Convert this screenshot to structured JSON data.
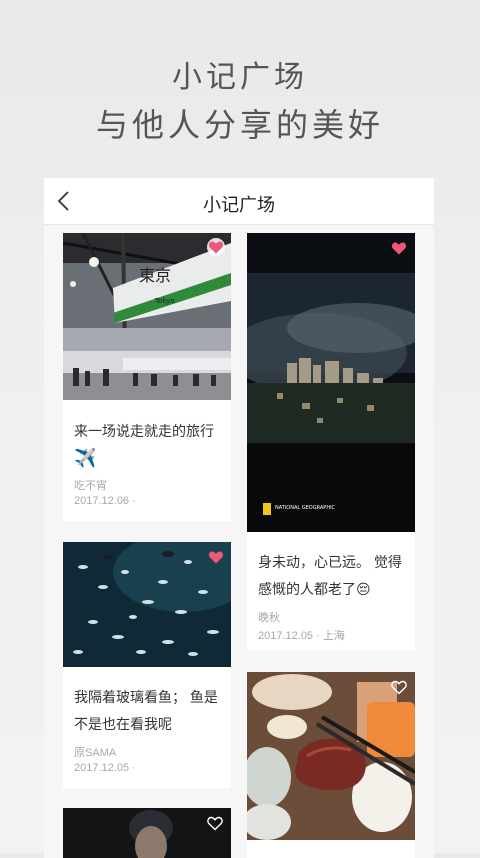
{
  "promo": {
    "line1": "小记广场",
    "line2": "与他人分享的美好"
  },
  "navbar": {
    "title": "小记广场"
  },
  "cards": [
    {
      "caption_line1": "来一场说走就走的旅行",
      "emoji": "✈️",
      "author": "吃不宵",
      "meta": "2017.12.06 ·",
      "sign_main": "東京",
      "sign_sub": "Tokyo"
    },
    {
      "caption_line1": "身未动，心已远。 觉得",
      "caption_line2": "感慨的人都老了",
      "emoji": "😔",
      "author": "晚秋",
      "meta": "2017.12.05 · 上海",
      "watermark": "NATIONAL GEOGRAPHIC"
    },
    {
      "caption_line1": "我隔着玻璃看鱼； 鱼是",
      "caption_line2": "不是也在看我呢",
      "author": "原SAMA",
      "meta": "2017.12.05 ·"
    },
    {},
    {}
  ],
  "colors": {
    "heart": "#f0557a",
    "text": "#333333",
    "muted": "#a8a8a8"
  }
}
